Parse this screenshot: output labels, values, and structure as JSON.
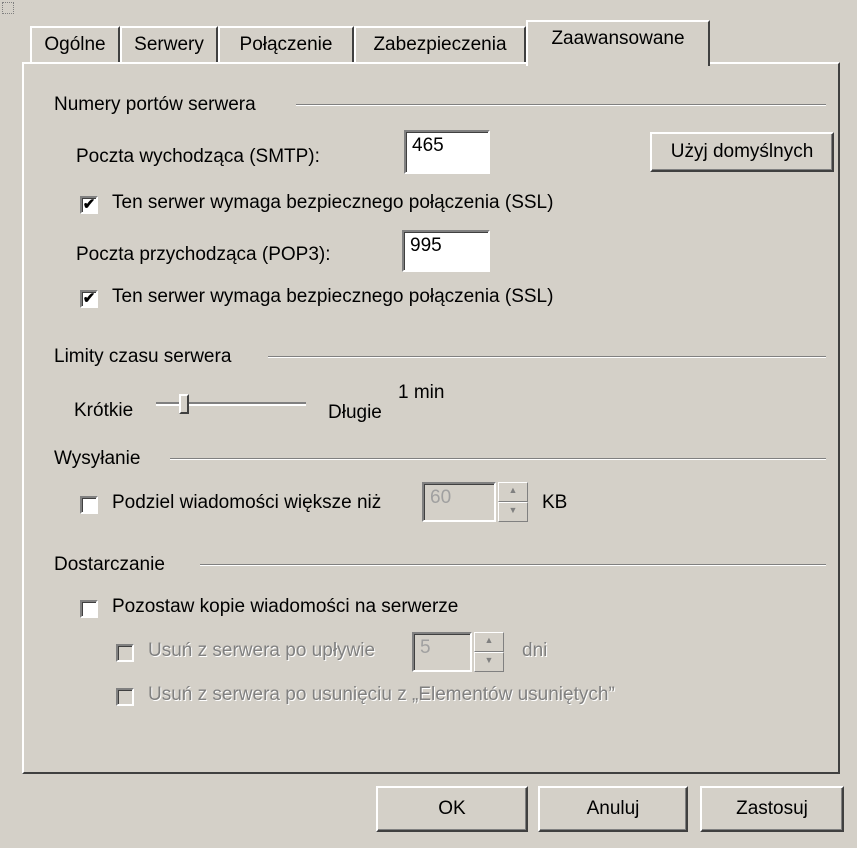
{
  "tabs": [
    {
      "label": "Ogólne"
    },
    {
      "label": "Serwery"
    },
    {
      "label": "Połączenie"
    },
    {
      "label": "Zabezpieczenia"
    },
    {
      "label": "Zaawansowane",
      "active": true
    }
  ],
  "ports": {
    "title": "Numery portów serwera",
    "smtp_label": "Poczta wychodząca (SMTP):",
    "smtp_value": "465",
    "default_button": "Użyj domyślnych",
    "smtp_ssl_label": "Ten serwer wymaga bezpiecznego połączenia (SSL)",
    "smtp_ssl_checked": "✔",
    "pop3_label": "Poczta przychodząca (POP3):",
    "pop3_value": "995",
    "pop3_ssl_label": "Ten serwer wymaga bezpiecznego połączenia (SSL)",
    "pop3_ssl_checked": "✔"
  },
  "timeouts": {
    "title": "Limity czasu serwera",
    "short_label": "Krótkie",
    "long_label": "Długie",
    "value": "1 min",
    "slider_level": 0.18
  },
  "sending": {
    "title": "Wysyłanie",
    "split_label": "Podziel wiadomości większe niż",
    "split_value": "60",
    "unit": "KB"
  },
  "delivery": {
    "title": "Dostarczanie",
    "leave_copy_label": "Pozostaw kopie wiadomości na serwerze",
    "remove_after_label": "Usuń z serwera po upływie",
    "remove_after_value": "5",
    "days_label": "dni",
    "remove_deleted_label": "Usuń z serwera po usunięciu z „Elementów usuniętych”"
  },
  "footer": {
    "ok": "OK",
    "cancel": "Anuluj",
    "apply": "Zastosuj"
  }
}
